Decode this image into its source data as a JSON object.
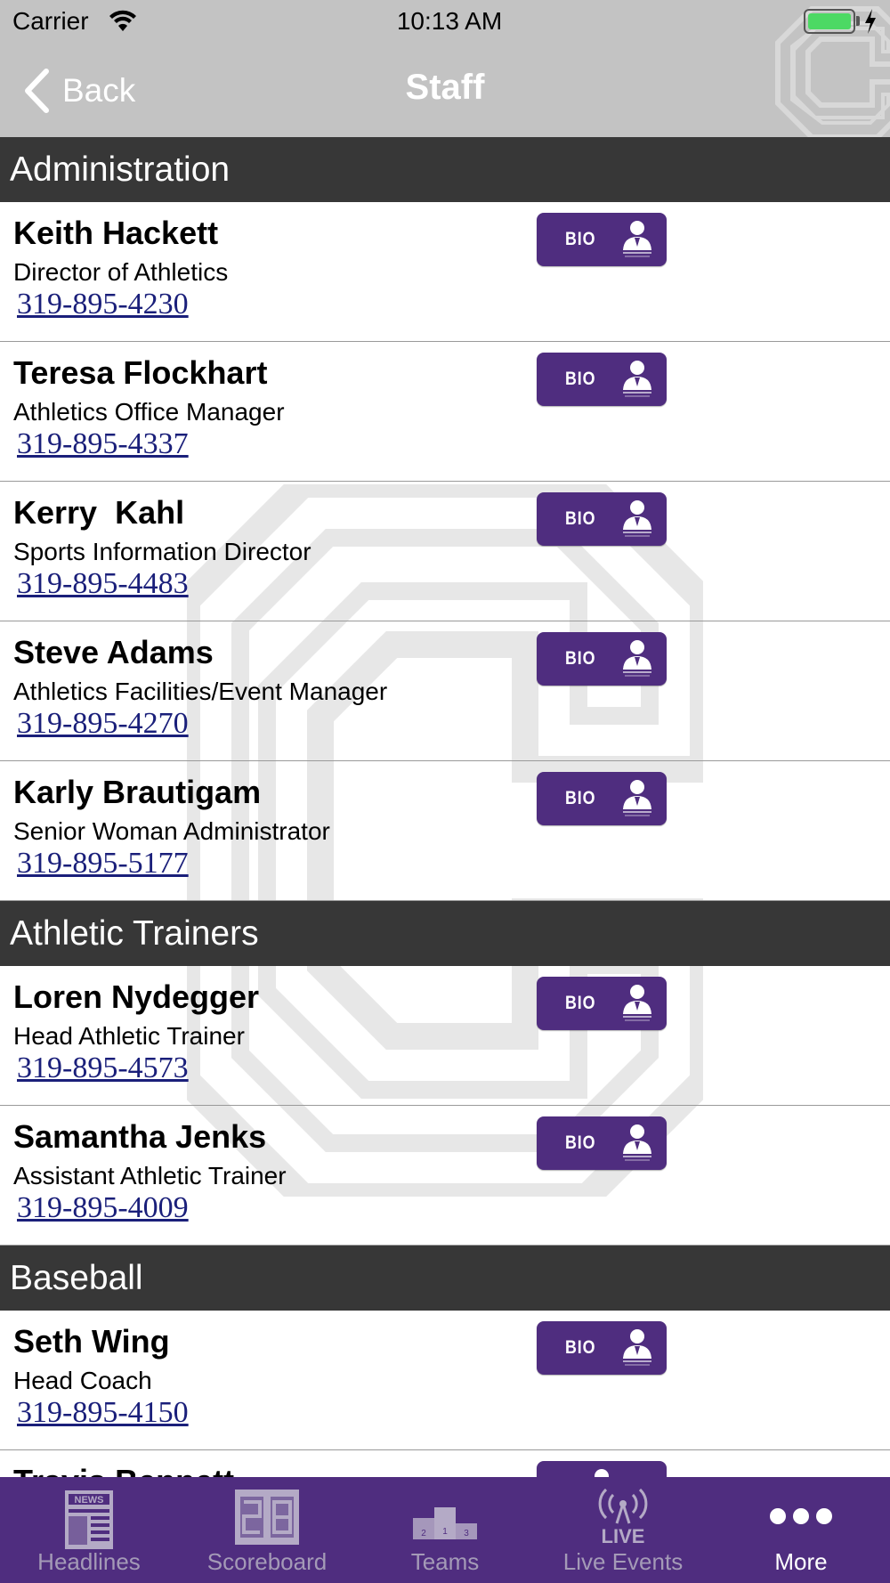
{
  "status_bar": {
    "carrier": "Carrier",
    "time": "10:13 AM"
  },
  "nav": {
    "back_label": "Back",
    "title": "Staff"
  },
  "colors": {
    "accent": "#4f2d7f",
    "header_bg": "#373737",
    "nav_bg": "#c3c3c3",
    "link": "#1a1f7a"
  },
  "sections": [
    {
      "title": "Administration",
      "staff": [
        {
          "name": "Keith Hackett",
          "title": "Director of Athletics",
          "phone": "319-895-4230",
          "bio_label": "BIO"
        },
        {
          "name": "Teresa Flockhart",
          "title": "Athletics Office Manager",
          "phone": "319-895-4337",
          "bio_label": "BIO"
        },
        {
          "name": "Kerry  Kahl",
          "title": "Sports Information Director",
          "phone": "319-895-4483",
          "bio_label": "BIO"
        },
        {
          "name": "Steve Adams",
          "title": "Athletics Facilities/Event Manager",
          "phone": "319-895-4270",
          "bio_label": "BIO"
        },
        {
          "name": "Karly Brautigam",
          "title": "Senior Woman Administrator",
          "phone": "319-895-5177",
          "bio_label": "BIO"
        }
      ]
    },
    {
      "title": "Athletic Trainers",
      "staff": [
        {
          "name": "Loren Nydegger",
          "title": "Head Athletic Trainer",
          "phone": "319-895-4573",
          "bio_label": "BIO"
        },
        {
          "name": "Samantha Jenks",
          "title": "Assistant Athletic Trainer",
          "phone": "319-895-4009",
          "bio_label": "BIO"
        }
      ]
    },
    {
      "title": "Baseball",
      "staff": [
        {
          "name": "Seth Wing",
          "title": "Head Coach",
          "phone": "319-895-4150",
          "bio_label": "BIO"
        },
        {
          "name": "Travis Bennett",
          "title": "",
          "phone": "",
          "bio_label": ""
        }
      ]
    }
  ],
  "tabs": [
    {
      "label": "Headlines",
      "icon": "newspaper-icon",
      "active": false
    },
    {
      "label": "Scoreboard",
      "icon": "scoreboard-icon",
      "active": false
    },
    {
      "label": "Teams",
      "icon": "podium-icon",
      "active": false
    },
    {
      "label": "Live Events",
      "icon": "live-broadcast-icon",
      "active": false
    },
    {
      "label": "More",
      "icon": "more-dots-icon",
      "active": true
    }
  ]
}
